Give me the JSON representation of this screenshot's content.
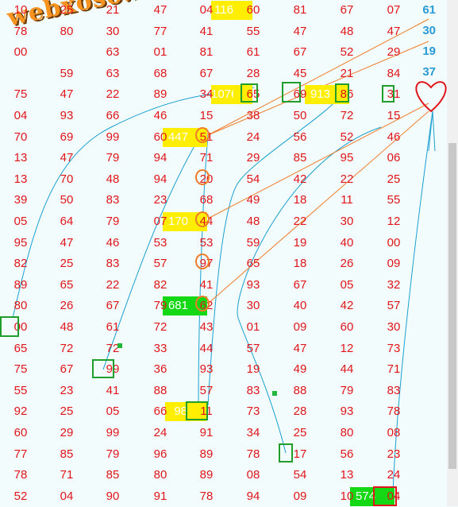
{
  "grid": {
    "rows": [
      [
        "10",
        "25",
        "21",
        "47",
        "04",
        "60",
        "81",
        "67",
        "07"
      ],
      [
        "78",
        "80",
        "30",
        "77",
        "41",
        "55",
        "47",
        "48",
        "47"
      ],
      [
        "00",
        "",
        "63",
        "01",
        "81",
        "61",
        "67",
        "52",
        "29"
      ],
      [
        "",
        "59",
        "63",
        "68",
        "67",
        "28",
        "45",
        "21",
        "84"
      ],
      [
        "75",
        "47",
        "22",
        "89",
        "34",
        "65",
        "69",
        "86",
        "31"
      ],
      [
        "04",
        "93",
        "66",
        "46",
        "15",
        "38",
        "50",
        "72",
        "15"
      ],
      [
        "70",
        "69",
        "99",
        "60",
        "51",
        "24",
        "56",
        "52",
        "46"
      ],
      [
        "13",
        "47",
        "79",
        "94",
        "71",
        "29",
        "85",
        "95",
        "06"
      ],
      [
        "13",
        "70",
        "48",
        "94",
        "20",
        "54",
        "42",
        "22",
        "25"
      ],
      [
        "39",
        "50",
        "83",
        "23",
        "68",
        "49",
        "18",
        "11",
        "55"
      ],
      [
        "05",
        "64",
        "79",
        "07",
        "44",
        "48",
        "22",
        "30",
        "12"
      ],
      [
        "95",
        "47",
        "46",
        "53",
        "53",
        "59",
        "19",
        "40",
        "00"
      ],
      [
        "82",
        "25",
        "83",
        "57",
        "97",
        "65",
        "18",
        "26",
        "09"
      ],
      [
        "89",
        "65",
        "22",
        "82",
        "41",
        "93",
        "67",
        "05",
        "32"
      ],
      [
        "80",
        "26",
        "67",
        "79",
        "62",
        "30",
        "40",
        "42",
        "57"
      ],
      [
        "00",
        "48",
        "61",
        "72",
        "43",
        "01",
        "09",
        "60",
        "30"
      ],
      [
        "65",
        "72",
        "72",
        "33",
        "44",
        "57",
        "47",
        "12",
        "73"
      ],
      [
        "75",
        "67",
        "99",
        "36",
        "93",
        "19",
        "49",
        "44",
        "71"
      ],
      [
        "55",
        "23",
        "41",
        "88",
        "57",
        "83",
        "88",
        "79",
        "83"
      ],
      [
        "92",
        "25",
        "05",
        "66",
        "11",
        "73",
        "28",
        "93",
        "78"
      ],
      [
        "60",
        "29",
        "99",
        "24",
        "91",
        "34",
        "25",
        "80",
        "08"
      ],
      [
        "77",
        "85",
        "79",
        "96",
        "89",
        "78",
        "17",
        "56",
        "23"
      ],
      [
        "78",
        "71",
        "85",
        "80",
        "89",
        "08",
        "54",
        "13",
        "24"
      ],
      [
        "52",
        "04",
        "90",
        "91",
        "78",
        "94",
        "09",
        "10",
        "04"
      ]
    ]
  },
  "highlights": [
    {
      "row": 0,
      "text": "116",
      "kind": "yellow"
    },
    {
      "row": 4,
      "text": "1076",
      "kind": "yellow"
    },
    {
      "row": 4,
      "text": "913",
      "kind": "yellow"
    },
    {
      "row": 6,
      "text": "447",
      "kind": "yellow"
    },
    {
      "row": 10,
      "text": "170",
      "kind": "yellow"
    },
    {
      "row": 14,
      "text": "681",
      "kind": "green"
    },
    {
      "row": 19,
      "text": "98",
      "kind": "yellow"
    },
    {
      "row": 23,
      "text": "574",
      "kind": "green"
    }
  ],
  "side_numbers": [
    "61",
    "30",
    "19",
    "37"
  ],
  "watermark": "webxoso.net",
  "colors": {
    "background": "#f3fcfd",
    "number": "#e0151a",
    "highlight_yellow": "#ffee00",
    "highlight_green": "#13d813",
    "box_green": "#1f9e2e",
    "circle_orange": "#f07c2a",
    "line_blue": "#1a9fd0",
    "line_orange": "#f07c2a",
    "side_number": "#2a9ad6",
    "heart": "#e0151a"
  },
  "icons": [
    "heart-icon"
  ]
}
